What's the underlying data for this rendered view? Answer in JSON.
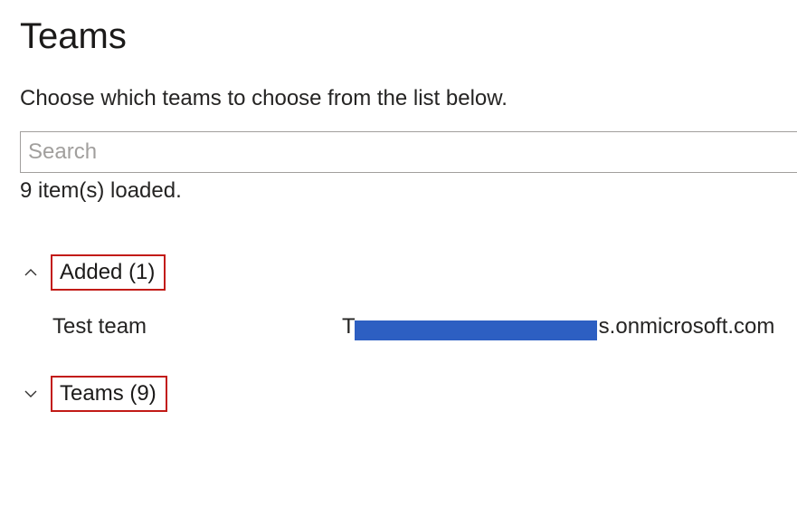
{
  "page": {
    "title": "Teams",
    "instruction": "Choose which teams to choose from the list below."
  },
  "search": {
    "placeholder": "Search",
    "value": ""
  },
  "status": {
    "loaded_text": "9 item(s) loaded."
  },
  "groups": {
    "added": {
      "label": "Added (1)",
      "expanded": true,
      "rows": [
        {
          "name": "Test team",
          "email_prefix": "T",
          "email_suffix": "s.onmicrosoft.com",
          "redacted": true
        }
      ]
    },
    "teams": {
      "label": "Teams (9)",
      "expanded": false
    }
  },
  "colors": {
    "highlight_outline": "#c21b17",
    "redaction": "#2d5fc2"
  }
}
